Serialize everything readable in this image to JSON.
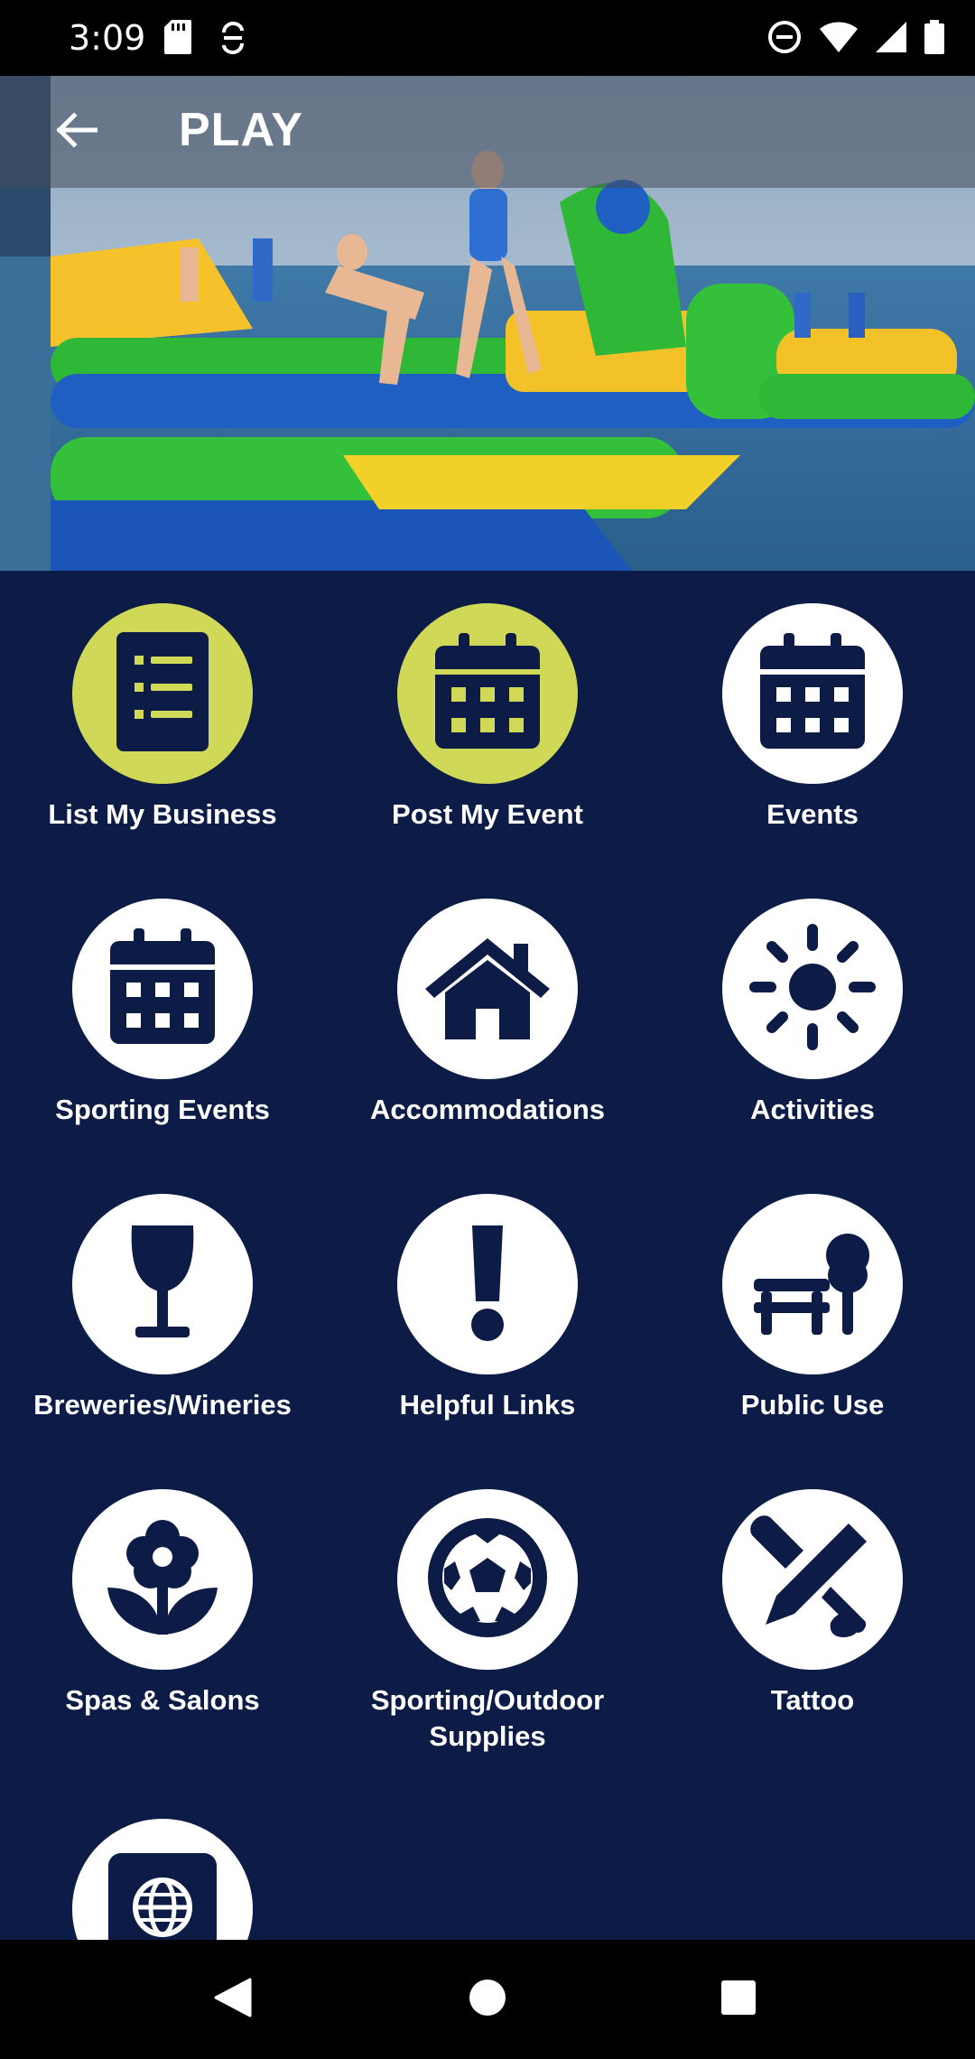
{
  "status_bar": {
    "time": "3:09",
    "left_icons": [
      "sd-card-icon",
      "sync-icon"
    ],
    "right_icons": [
      "do-not-disturb-icon",
      "wifi-icon",
      "signal-icon",
      "battery-icon"
    ]
  },
  "app_bar": {
    "title": "PLAY",
    "back_icon": "arrow-left-icon"
  },
  "hero": {
    "image": "inflatable-water-park-photo"
  },
  "categories": [
    {
      "label": "List My Business",
      "icon": "list-icon",
      "accent": true
    },
    {
      "label": "Post My Event",
      "icon": "calendar-icon",
      "accent": true
    },
    {
      "label": "Events",
      "icon": "calendar-icon",
      "accent": false
    },
    {
      "label": "Sporting Events",
      "icon": "calendar-icon",
      "accent": false
    },
    {
      "label": "Accommodations",
      "icon": "house-icon",
      "accent": false
    },
    {
      "label": "Activities",
      "icon": "sun-icon",
      "accent": false
    },
    {
      "label": "Breweries/Wineries",
      "icon": "wine-glass-icon",
      "accent": false
    },
    {
      "label": "Helpful Links",
      "icon": "exclamation-icon",
      "accent": false
    },
    {
      "label": "Public Use",
      "icon": "bench-tree-icon",
      "accent": false
    },
    {
      "label": "Spas & Salons",
      "icon": "flower-icon",
      "accent": false
    },
    {
      "label": "Sporting/Outdoor Supplies",
      "icon": "soccer-ball-icon",
      "accent": false
    },
    {
      "label": "Tattoo",
      "icon": "pencil-brush-icon",
      "accent": false
    },
    {
      "label": "",
      "icon": "globe-icon",
      "accent": false
    }
  ],
  "colors": {
    "background": "#0d1b47",
    "accent": "#cfd957",
    "tile": "#ffffff",
    "icon": "#0d1b47"
  },
  "nav_bar": {
    "icons": [
      "back-triangle-icon",
      "home-circle-icon",
      "recents-square-icon"
    ]
  }
}
